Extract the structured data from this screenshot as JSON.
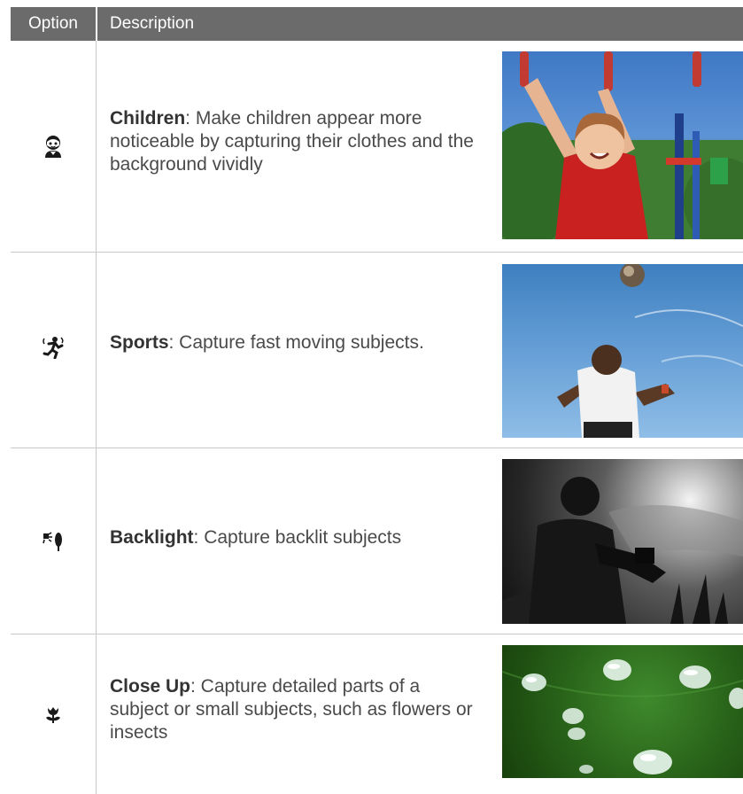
{
  "header": {
    "option": "Option",
    "description": "Description"
  },
  "rows": [
    {
      "icon": "child-face-icon",
      "title": "Children",
      "text": ": Make children appear more noticeable by capturing their clothes and the background vividly",
      "photo": "children-photo"
    },
    {
      "icon": "running-figure-icon",
      "title": "Sports",
      "text": ": Capture fast moving subjects.",
      "photo": "sports-photo"
    },
    {
      "icon": "backlight-tree-icon",
      "title": "Backlight",
      "text": ": Capture backlit subjects",
      "photo": "backlight-photo"
    },
    {
      "icon": "flower-icon",
      "title": "Close Up",
      "text": ": Capture detailed parts of a subject or small subjects, such as flowers or insects",
      "photo": "closeup-photo"
    }
  ]
}
